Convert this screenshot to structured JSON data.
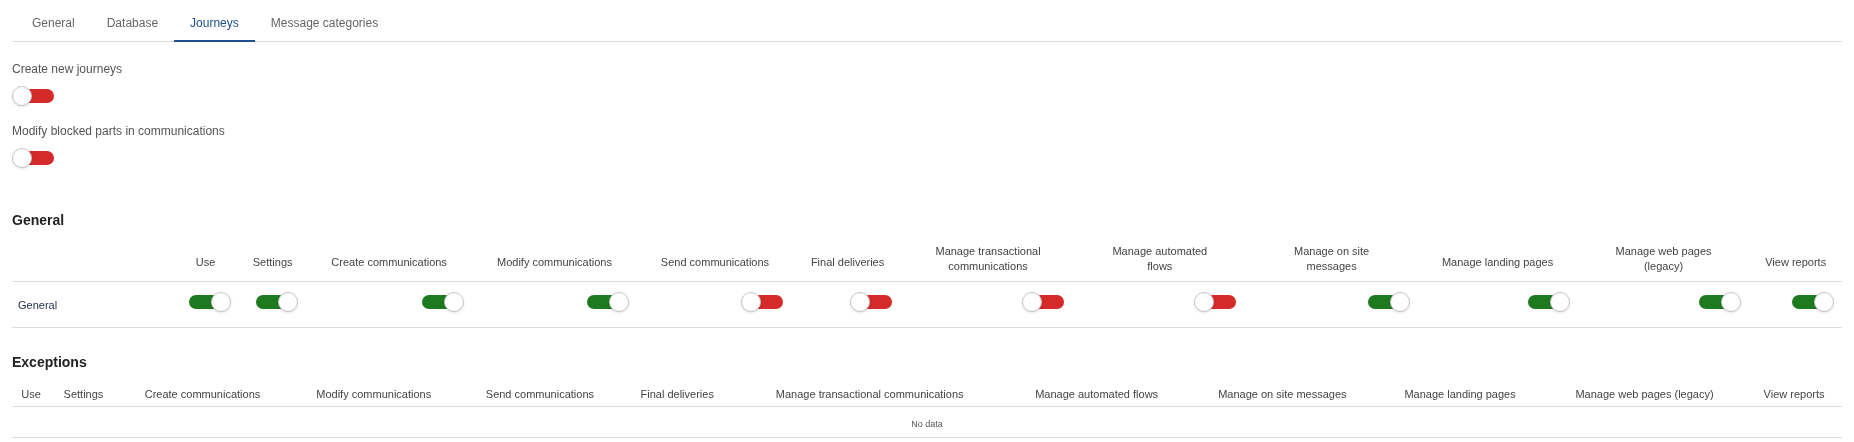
{
  "tabs": [
    {
      "label": "General",
      "selected": false
    },
    {
      "label": "Database",
      "selected": false
    },
    {
      "label": "Journeys",
      "selected": true
    },
    {
      "label": "Message categories",
      "selected": false
    }
  ],
  "settings": [
    {
      "label": "Create new journeys",
      "on": false
    },
    {
      "label": "Modify blocked parts in communications",
      "on": false
    }
  ],
  "general": {
    "title": "General",
    "columns": [
      "Use",
      "Settings",
      "Create communications",
      "Modify communications",
      "Send communications",
      "Final deliveries",
      "Manage transactional communications",
      "Manage automated flows",
      "Manage on site messages",
      "Manage landing pages",
      "Manage web pages (legacy)",
      "View reports"
    ],
    "rows": [
      {
        "label": "General",
        "toggles": [
          {
            "on": true
          },
          {
            "on": true
          },
          {
            "on": true
          },
          {
            "on": true
          },
          {
            "on": false
          },
          {
            "on": false
          },
          {
            "on": false
          },
          {
            "on": false
          },
          {
            "on": true
          },
          {
            "on": true
          },
          {
            "on": true
          },
          {
            "on": true
          }
        ]
      }
    ]
  },
  "exceptions": {
    "title": "Exceptions",
    "columns": [
      "Use",
      "Settings",
      "Create communications",
      "Modify communications",
      "Send communications",
      "Final deliveries",
      "Manage transactional communications",
      "Manage automated flows",
      "Manage on site messages",
      "Manage landing pages",
      "Manage web pages (legacy)",
      "View reports"
    ],
    "empty_text": "No data"
  }
}
